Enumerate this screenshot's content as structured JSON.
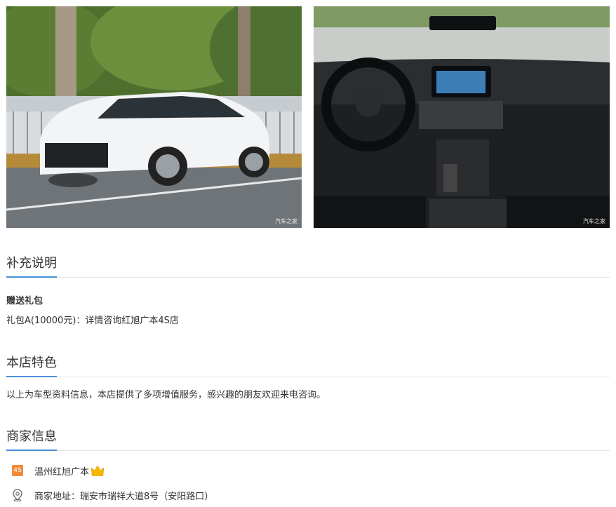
{
  "photos": {
    "left_watermark": "汽车之家",
    "right_watermark": "汽车之家"
  },
  "supplement": {
    "title": "补充说明",
    "gift_title": "赠送礼包",
    "gift_detail": "礼包A(10000元)：详情咨询红旭广本4S店"
  },
  "features": {
    "title": "本店特色",
    "text": "以上为车型资料信息，本店提供了多项增值服务，感兴趣的朋友欢迎来电咨询。"
  },
  "merchant": {
    "title": "商家信息",
    "badge": "4S",
    "name": "温州红旭广本",
    "address": "商家地址：瑞安市瑞祥大道8号（安阳路口）",
    "icons": [
      "4s-badge-icon",
      "crown-icon",
      "location-pin-icon"
    ]
  },
  "colors": {
    "accent": "#4a90d9",
    "badge": "#f08a3a",
    "crown": "#f5b800"
  }
}
